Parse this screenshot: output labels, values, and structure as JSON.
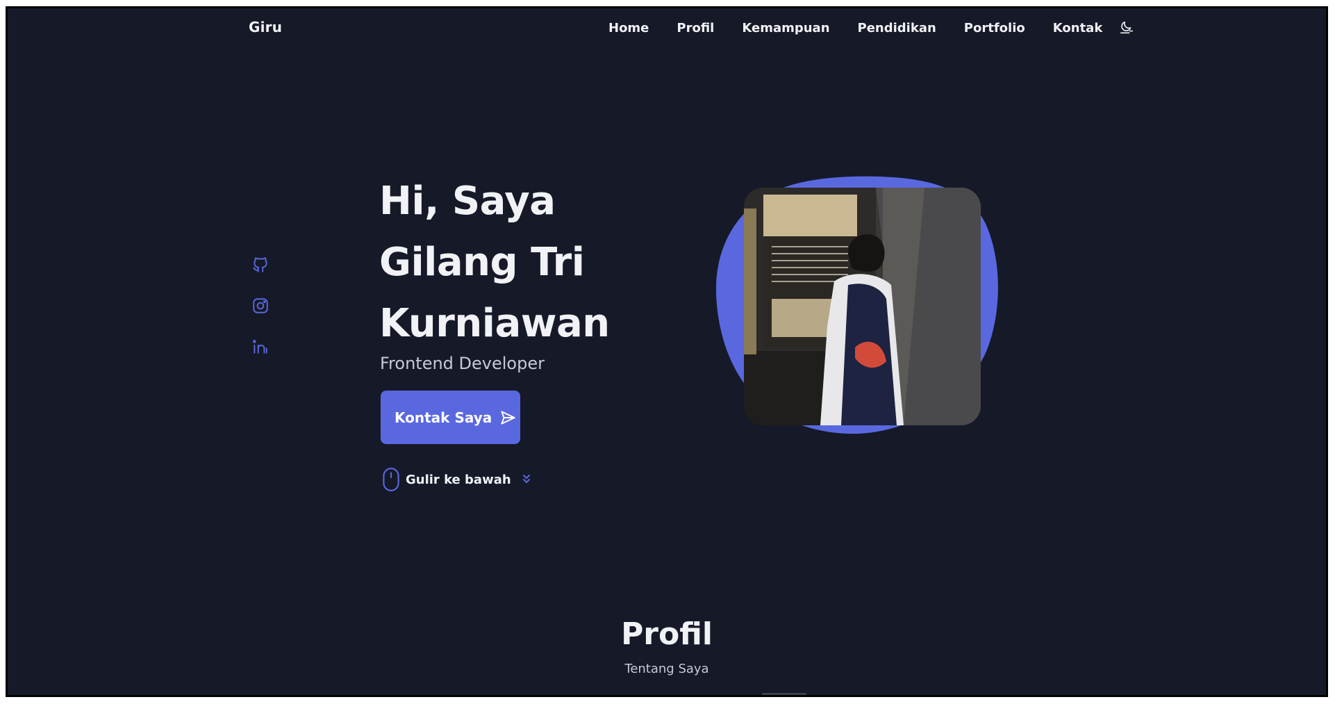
{
  "header": {
    "logo": "Giru",
    "nav": [
      "Home",
      "Profil",
      "Kemampuan",
      "Pendidikan",
      "Portfolio",
      "Kontak"
    ],
    "theme_icon": "moon-icon"
  },
  "social": {
    "icons": [
      "github-icon",
      "instagram-icon",
      "linkedin-icon"
    ]
  },
  "hero": {
    "title_lines": [
      "Hi, Saya",
      "Gilang Tri",
      "Kurniawan"
    ],
    "subtitle": "Frontend Developer",
    "cta_label": "Kontak Saya",
    "scroll_label": "Gulir ke bawah"
  },
  "profile": {
    "title": "Profil",
    "subtitle": "Tentang Saya"
  },
  "colors": {
    "background": "#161a28",
    "accent": "#5a68e0",
    "text": "#f1f2f6",
    "muted": "#c6c9d6"
  }
}
